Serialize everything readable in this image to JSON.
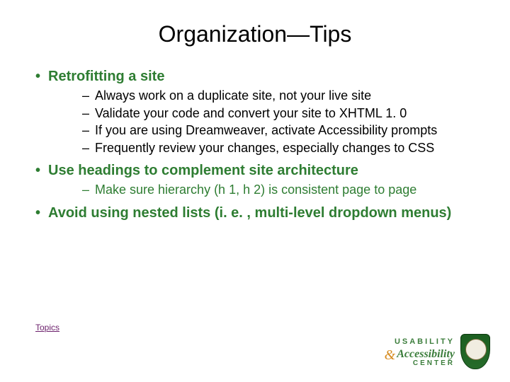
{
  "title": "Organization—Tips",
  "bullets": {
    "b1": {
      "text": "Retrofitting a site",
      "subs": [
        "Always work on a duplicate site, not your live site",
        "Validate your code and convert your site to XHTML 1. 0",
        "If you are using Dreamweaver, activate Accessibility prompts",
        "Frequently review your changes, especially changes to CSS"
      ]
    },
    "b2": {
      "text": "Use headings to complement site architecture",
      "subs": [
        "Make sure hierarchy (h 1, h 2) is consistent  page to page"
      ]
    },
    "b3": {
      "text": "Avoid using nested lists (i. e. , multi-level dropdown menus)"
    }
  },
  "link": {
    "topics": "Topics"
  },
  "footer": {
    "usability": "USABILITY",
    "amp": "&",
    "accessibility": "Accessibility",
    "center": "CENTER"
  }
}
